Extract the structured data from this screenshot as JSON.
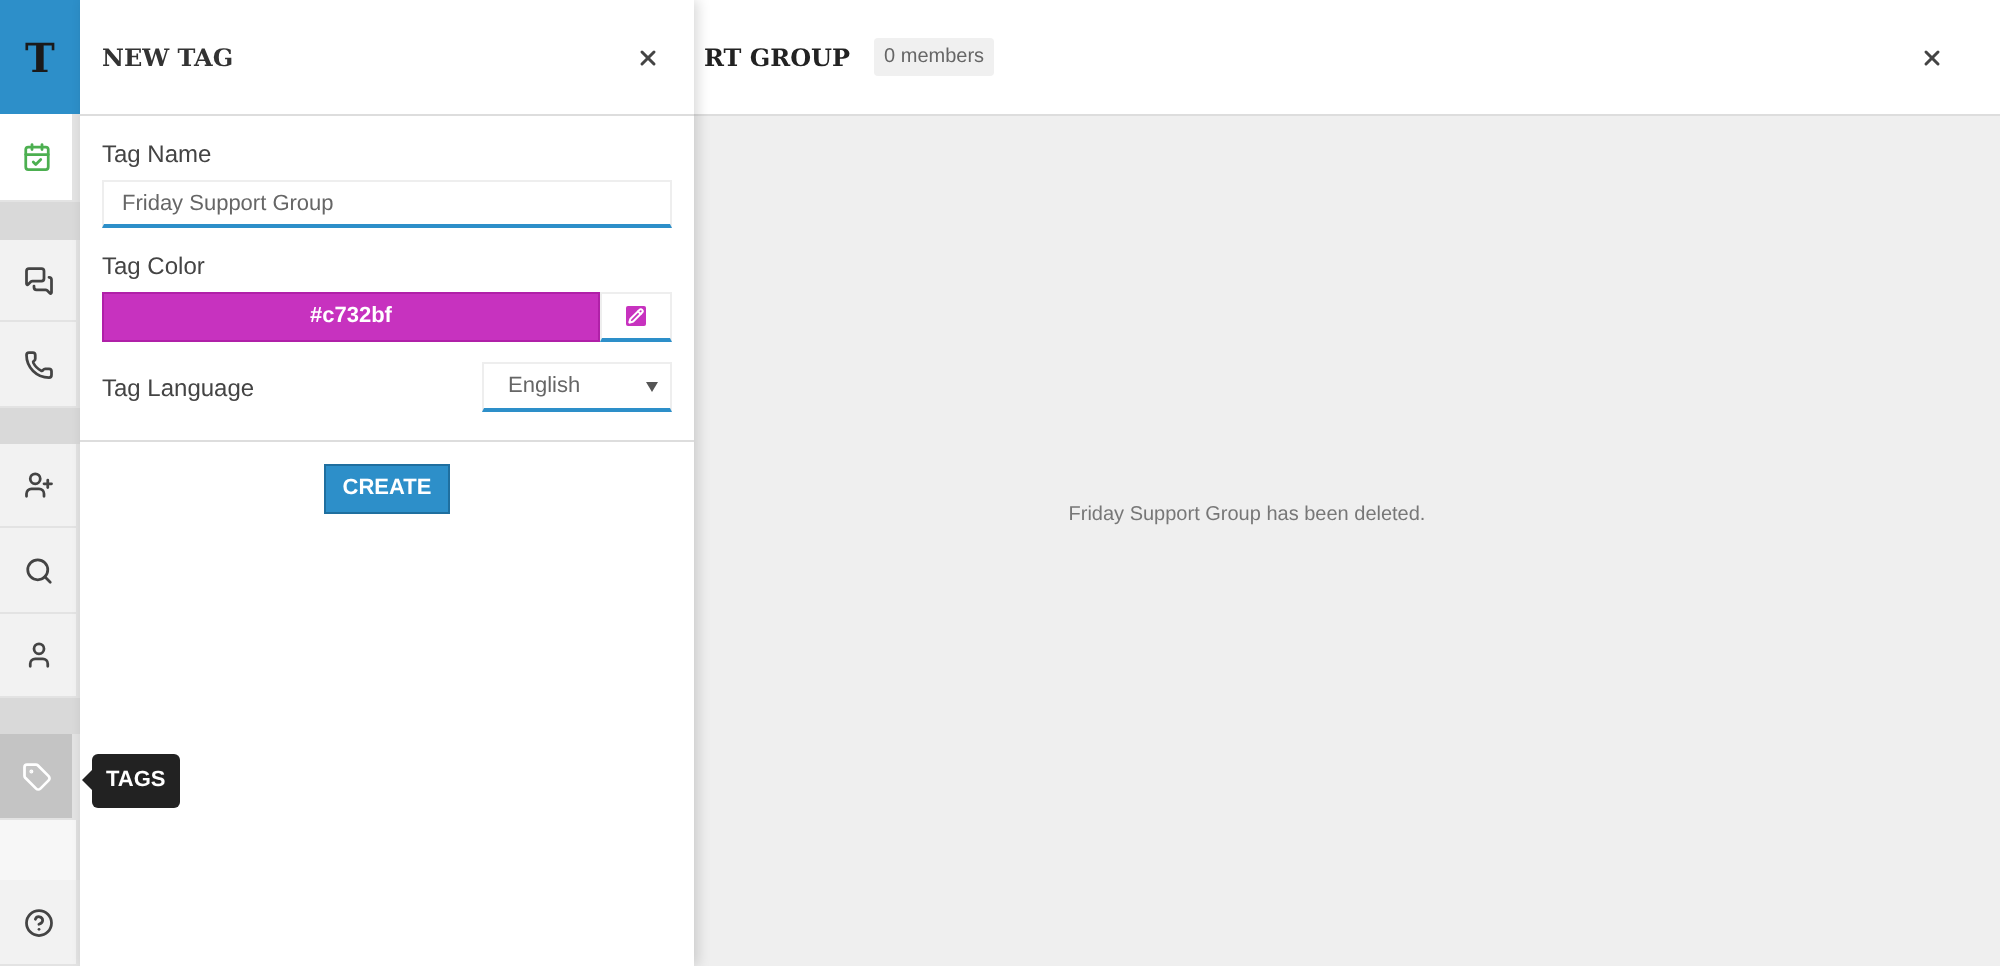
{
  "sidebar": {
    "items": [
      {
        "kind": "logo",
        "label": "T"
      },
      {
        "kind": "item",
        "selected": true
      },
      {
        "kind": "spacer"
      },
      {
        "kind": "item",
        "selected": false
      },
      {
        "kind": "item",
        "selected": false
      },
      {
        "kind": "spacer"
      },
      {
        "kind": "item",
        "selected": false
      },
      {
        "kind": "item",
        "selected": false
      },
      {
        "kind": "item",
        "selected": false
      },
      {
        "kind": "spacer"
      },
      {
        "kind": "item",
        "selected": false,
        "hovered": true
      },
      {
        "kind": "blank"
      },
      {
        "kind": "item",
        "selected": false
      }
    ],
    "tooltip": "TAGS"
  },
  "panel": {
    "title": "NEW TAG",
    "name_label": "Tag Name",
    "name_value": "Friday Support Group",
    "color_label": "Tag Color",
    "color": "#c732bf",
    "color_text": "#c732bf",
    "language_label": "Tag Language",
    "language": "English",
    "create": "CREATE"
  },
  "main": {
    "title": "RT GROUP",
    "members": "0 members",
    "message": "Friday Support Group has been deleted."
  }
}
